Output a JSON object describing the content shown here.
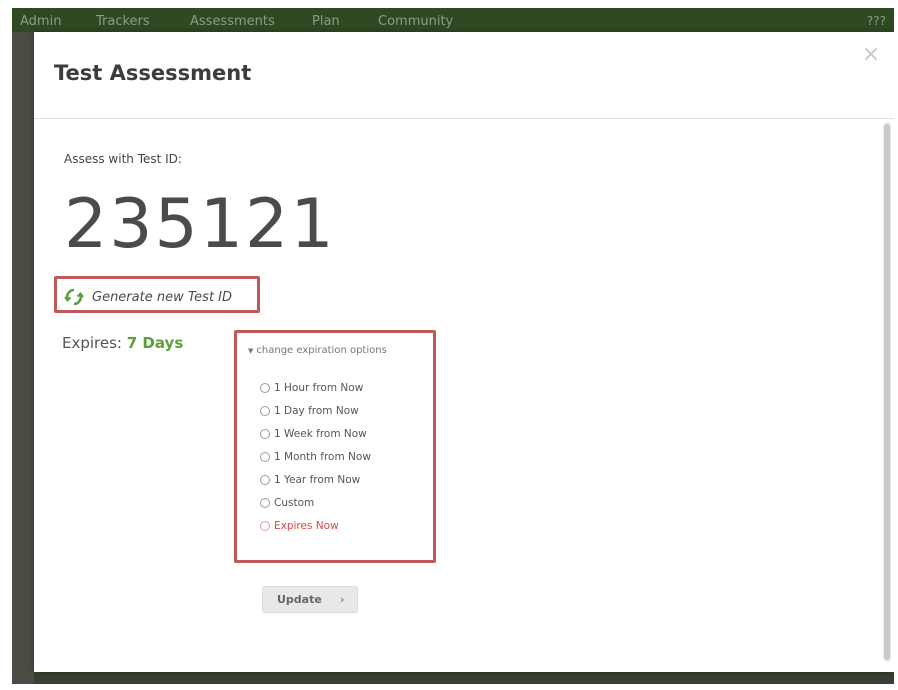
{
  "nav": {
    "items": [
      "Admin",
      "Trackers",
      "Assessments",
      "Plan",
      "Community"
    ],
    "extra": "???"
  },
  "modal": {
    "title": "Test Assessment",
    "close_icon": "close-icon"
  },
  "assess": {
    "label": "Assess with Test ID:",
    "test_id": "235121",
    "generate_label": "Generate new Test ID",
    "generate_icon": "refresh-icon"
  },
  "expires": {
    "label": "Expires:",
    "value": "7 Days"
  },
  "options": {
    "toggle_label": "change expiration options",
    "items": [
      "1 Hour from Now",
      "1 Day from Now",
      "1 Week from Now",
      "1 Month from Now",
      "1 Year from Now",
      "Custom",
      "Expires Now"
    ]
  },
  "update": {
    "label": "Update",
    "arrow": "›"
  },
  "colors": {
    "accent_green": "#5f9e3a",
    "highlight_red": "#c0585a",
    "danger_text": "#d24848"
  }
}
